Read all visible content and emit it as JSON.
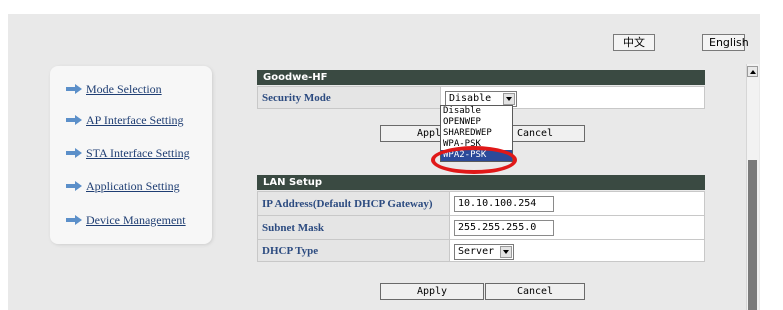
{
  "language": {
    "chinese_label": "中文",
    "english_label": "English"
  },
  "sidebar": {
    "items": [
      {
        "label": "Mode Selection"
      },
      {
        "label": "AP Interface Setting"
      },
      {
        "label": "STA Interface Setting"
      },
      {
        "label": "Application Setting"
      },
      {
        "label": "Device Management"
      }
    ]
  },
  "security_section": {
    "header": "Goodwe-HF",
    "security_mode_label": "Security Mode",
    "security_mode_value": "Disable",
    "options": [
      "Disable",
      "OPENWEP",
      "SHAREDWEP",
      "WPA-PSK",
      "WPA2-PSK"
    ],
    "highlighted_option": "WPA2-PSK",
    "apply_label": "Apply",
    "cancel_label": "Cancel"
  },
  "lan_section": {
    "header": "LAN Setup",
    "ip_label": "IP Address(Default DHCP Gateway)",
    "ip_value": "10.10.100.254",
    "subnet_label": "Subnet Mask",
    "subnet_value": "255.255.255.0",
    "dhcp_label": "DHCP Type",
    "dhcp_value": "Server",
    "apply_label": "Apply",
    "cancel_label": "Cancel"
  },
  "colors": {
    "header_bg": "#3a4a42",
    "label_text": "#2c4b80",
    "link_text": "#1f3e73",
    "selected_option_bg": "#2b4a9a",
    "annotation_ring": "#e01818"
  },
  "icons": {
    "sidebar_bullet": "arrow-right-icon"
  }
}
